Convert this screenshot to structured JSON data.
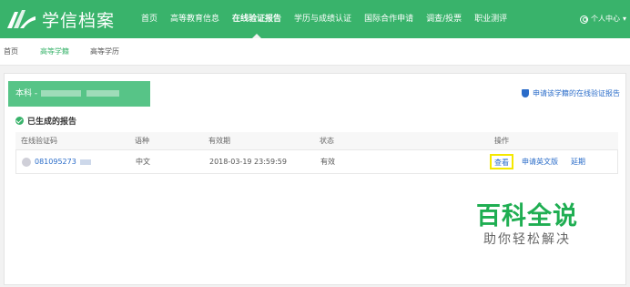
{
  "header": {
    "logo_text": "学信档案",
    "nav": [
      {
        "label": "首页"
      },
      {
        "label": "高等教育信息"
      },
      {
        "label": "在线验证报告"
      },
      {
        "label": "学历与成绩认证"
      },
      {
        "label": "国际合作申请"
      },
      {
        "label": "调查/投票"
      },
      {
        "label": "职业测评"
      }
    ],
    "active_nav": "在线验证报告",
    "user_menu": "个人中心",
    "brand_color": "#39b36b"
  },
  "subnav": {
    "items": [
      {
        "label": "首页"
      },
      {
        "label": "高等学籍"
      },
      {
        "label": "高等学历"
      }
    ],
    "active": "高等学籍"
  },
  "card": {
    "edu_tab_label": "本科 -",
    "apply_link": "申请该学籍的在线验证报告",
    "section_title": "已生成的报告",
    "table": {
      "headers": [
        "在线验证码",
        "语种",
        "有效期",
        "状态",
        "操作"
      ],
      "rows": [
        {
          "code": "081095273",
          "language": "中文",
          "valid_until": "2018-03-19 23:59:59",
          "status": "有效",
          "actions": {
            "view": "查看",
            "apply_english": "申请英文版",
            "extend": "延期"
          }
        }
      ]
    }
  },
  "watermark": {
    "main": "百科全说",
    "sub": "助你轻松解决"
  }
}
